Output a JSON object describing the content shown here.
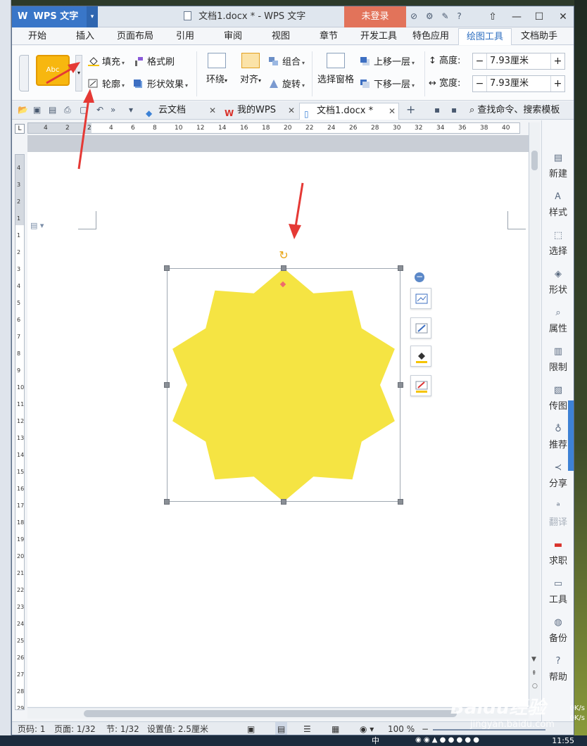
{
  "window": {
    "app_button_label": "WPS 文字",
    "title": "文档1.docx * - WPS 文字",
    "login_label": "未登录"
  },
  "tabs": [
    "开始",
    "插入",
    "页面布局",
    "引用",
    "审阅",
    "视图",
    "章节",
    "开发工具",
    "特色应用",
    "绘图工具",
    "文档助手"
  ],
  "active_tab": "绘图工具",
  "ribbon": {
    "style_preview": "Abc",
    "fill": "填充",
    "format_painter": "格式刷",
    "outline": "轮廓",
    "shape_effects": "形状效果",
    "wrap": "环绕",
    "align": "对齐",
    "group": "组合",
    "rotate": "旋转",
    "selection_pane": "选择窗格",
    "bring_forward": "上移一层",
    "send_backward": "下移一层",
    "height_label": "高度:",
    "height_value": "7.93厘米",
    "width_label": "宽度:",
    "width_value": "7.93厘米"
  },
  "docbar": {
    "tabs": [
      {
        "label": "云文档"
      },
      {
        "label": "我的WPS"
      },
      {
        "label": "文档1.docx *"
      }
    ],
    "search_placeholder": "查找命令、搜索模板"
  },
  "ruler": {
    "h_ticks": [
      "4",
      "2",
      "2",
      "4",
      "6",
      "8",
      "10",
      "12",
      "14",
      "16",
      "18",
      "20",
      "22",
      "24",
      "26",
      "28",
      "30",
      "32",
      "34",
      "36",
      "38",
      "40"
    ],
    "v_ticks": [
      "4",
      "3",
      "2",
      "1",
      "1",
      "2",
      "3",
      "4",
      "5",
      "6",
      "7",
      "8",
      "9",
      "10",
      "11",
      "12",
      "13",
      "14",
      "15",
      "16",
      "17",
      "18",
      "19",
      "20",
      "21",
      "22",
      "23",
      "24",
      "25",
      "26",
      "27",
      "28",
      "29"
    ]
  },
  "shape": {
    "fill_color": "#f5e443",
    "points": 10
  },
  "sidebar": {
    "items": [
      "新建",
      "样式",
      "选择",
      "形状",
      "属性",
      "限制",
      "传图",
      "推荐",
      "分享",
      "翻译",
      "求职",
      "工具",
      "备份",
      "帮助"
    ]
  },
  "status": {
    "page_no": "页码: 1",
    "pages": "页面: 1/32",
    "section": "节: 1/32",
    "setting": "设置值: 2.5厘米",
    "zoom": "100 %"
  },
  "taskbar": {
    "clock": "11:55",
    "ime": "中"
  },
  "watermark": {
    "brand": "Baidu经验",
    "url": "jingyan.baidu.com"
  },
  "net_speed": [
    "0K/s",
    "0K/s"
  ],
  "accent_color": "#3976c8",
  "annotation_color": "#e53935"
}
